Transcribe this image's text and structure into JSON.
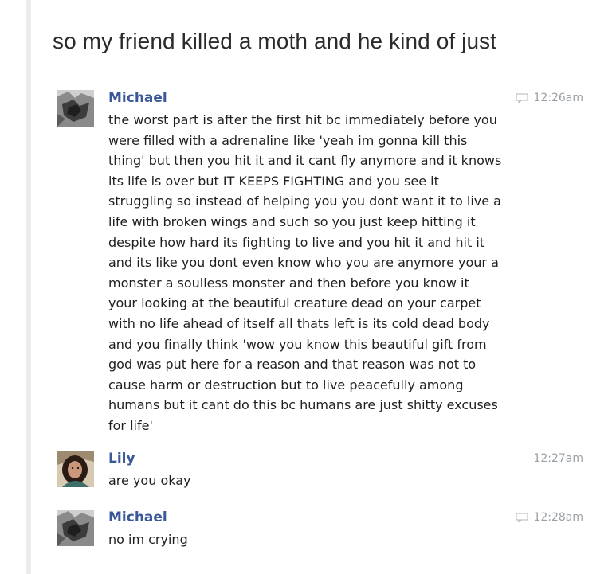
{
  "post": {
    "title": "so my friend killed a moth and he kind of just"
  },
  "messages": [
    {
      "sender": "Michael",
      "time": "12:26am",
      "has_chat_icon": true,
      "avatar": "michael-avatar",
      "text": "the worst part is after the first hit bc immediately before you\nwere filled with a adrenaline like 'yeah im gonna kill this\nthing' but then you hit it and it cant fly anymore and it knows\nits life is over but IT KEEPS FIGHTING and you see it\nstruggling so instead of helping you you dont want it to live a\nlife with broken wings and such so you just keep hitting it\ndespite how hard its fighting to live and you hit it and hit it\nand its like you dont even know who you are anymore your a\nmonster a soulless monster and then before you know it\nyour looking at the beautiful creature dead on your carpet\nwith no life ahead of itself all thats left is its cold dead body\nand you finally think 'wow you know this beautiful gift from\ngod was put here for a reason and that reason was not to\ncause harm or destruction but to live peacefully among\nhumans but it cant do this bc humans are just shitty excuses\nfor life'"
    },
    {
      "sender": "Lily",
      "time": "12:27am",
      "has_chat_icon": false,
      "avatar": "lily-avatar",
      "text": "are you okay"
    },
    {
      "sender": "Michael",
      "time": "12:28am",
      "has_chat_icon": true,
      "avatar": "michael-avatar",
      "text": "no im crying"
    }
  ],
  "colors": {
    "sender": "#3b5998",
    "time": "#9aa0a6",
    "text": "#1f1f1f",
    "rule": "#ececec"
  }
}
